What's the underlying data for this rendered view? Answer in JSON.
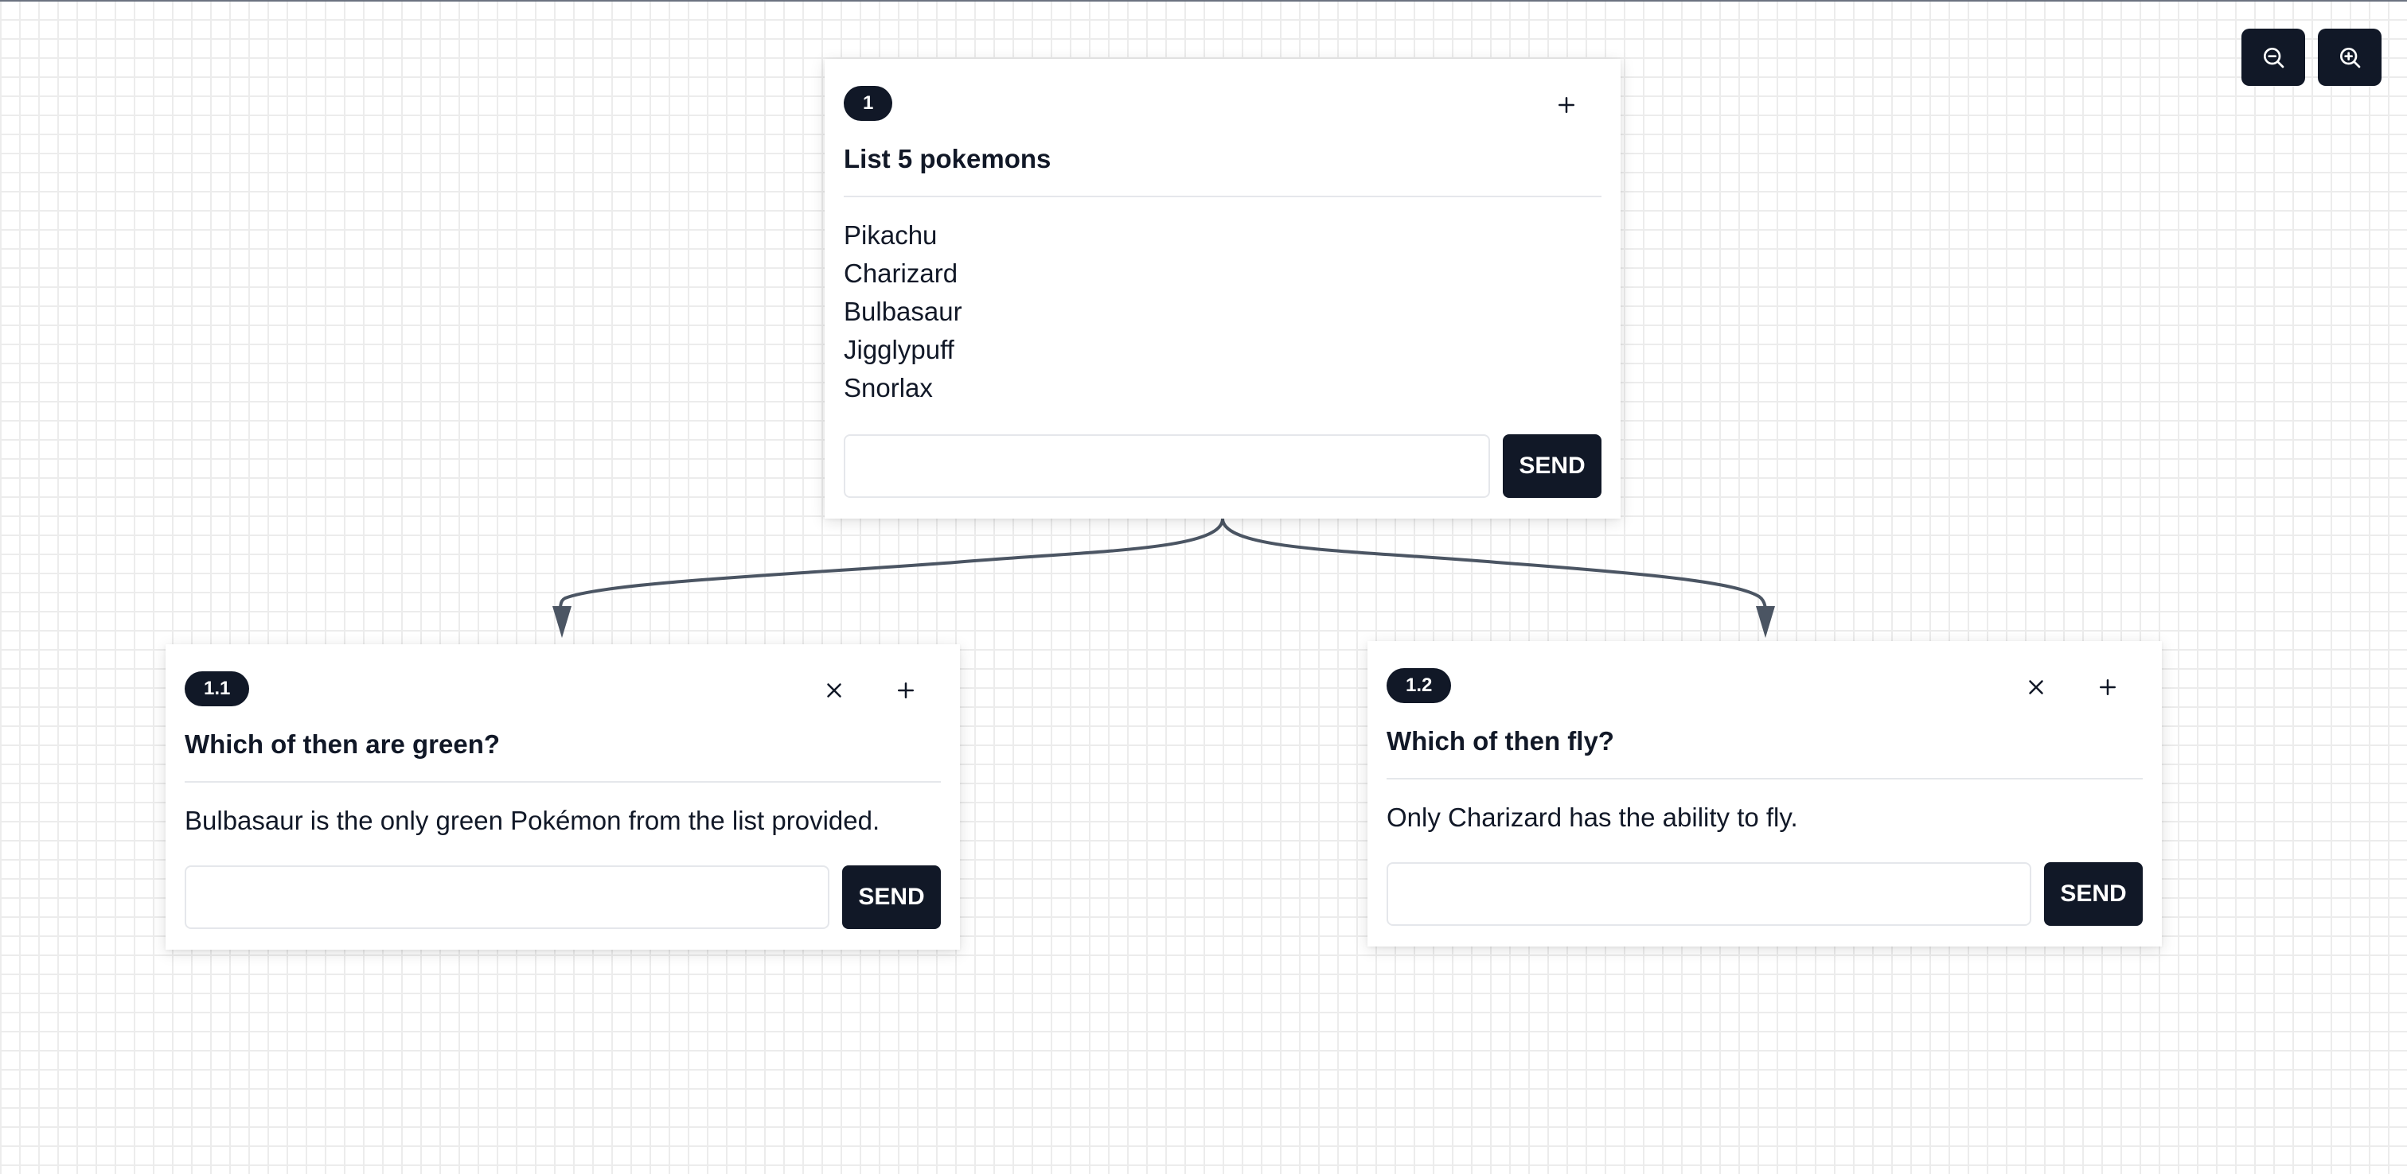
{
  "toolbar": {
    "zoom_out_icon": "zoom-out-icon",
    "zoom_in_icon": "zoom-in-icon"
  },
  "colors": {
    "primary": "#111827",
    "edge": "#4b5563",
    "grid": "#ececec"
  },
  "nodes": [
    {
      "id": "1",
      "badge": "1",
      "title": "List 5 pokemons",
      "body_lines": [
        "Pikachu",
        "Charizard",
        "Bulbasaur",
        "Jigglypuff",
        "Snorlax"
      ],
      "input_value": "",
      "input_placeholder": "",
      "send_label": "SEND",
      "has_close": false
    },
    {
      "id": "1.1",
      "badge": "1.1",
      "title": "Which of then are green?",
      "body_lines": [
        "Bulbasaur is the only green Pokémon from the list provided."
      ],
      "input_value": "",
      "input_placeholder": "",
      "send_label": "SEND",
      "has_close": true
    },
    {
      "id": "1.2",
      "badge": "1.2",
      "title": "Which of then fly?",
      "body_lines": [
        "Only Charizard has the ability to fly."
      ],
      "input_value": "",
      "input_placeholder": "",
      "send_label": "SEND",
      "has_close": true
    }
  ]
}
